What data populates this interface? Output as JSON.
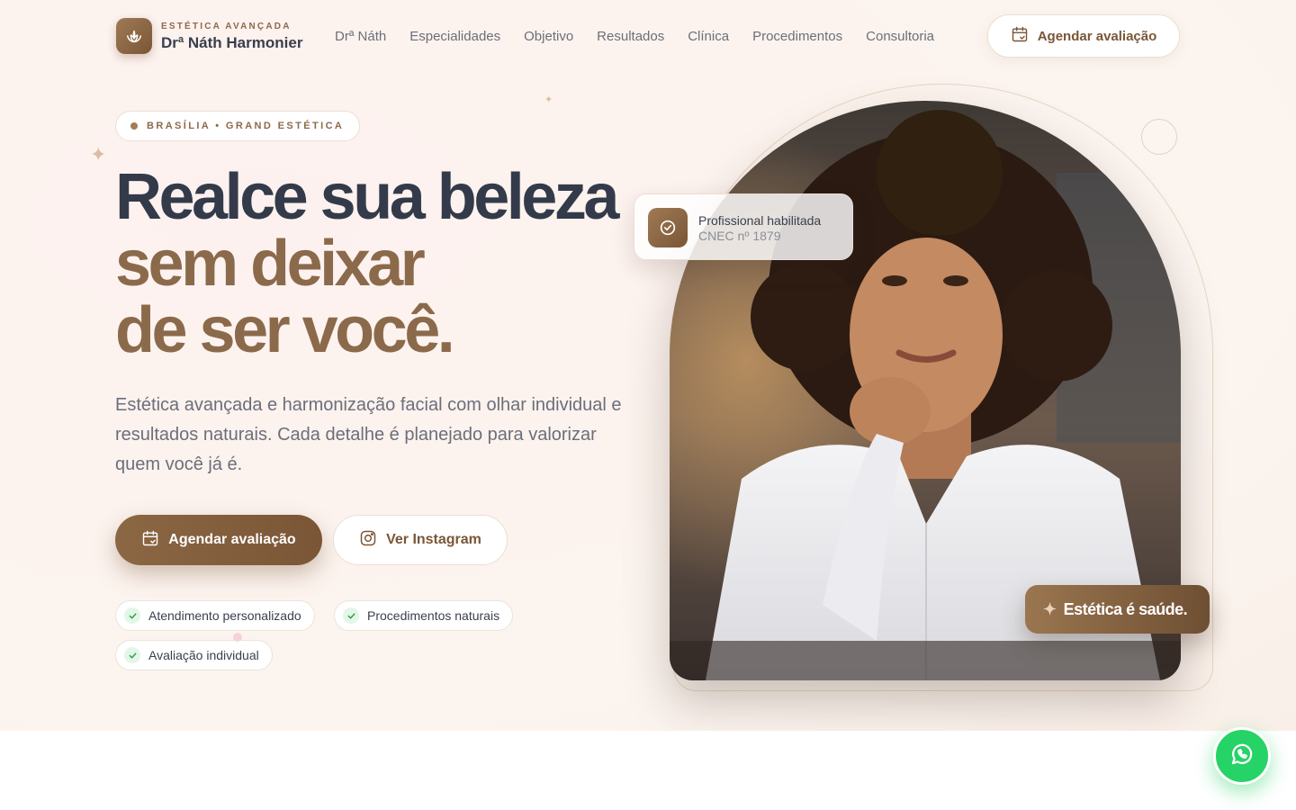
{
  "header": {
    "brand_subtitle": "ESTÉTICA AVANÇADA",
    "brand_name": "Drª Náth Harmonier",
    "nav": [
      {
        "label": "Drª Náth"
      },
      {
        "label": "Especialidades"
      },
      {
        "label": "Objetivo"
      },
      {
        "label": "Resultados"
      },
      {
        "label": "Clínica"
      },
      {
        "label": "Procedimentos"
      },
      {
        "label": "Consultoria"
      }
    ],
    "cta_label": "Agendar avaliação"
  },
  "hero": {
    "location_badge": "BRASÍLIA • GRAND ESTÉTICA",
    "headline_line1": "Realce sua beleza",
    "headline_line2": "sem deixar",
    "headline_line3": "de ser você.",
    "lede": "Estética avançada e harmonização facial com olhar individual e resultados naturais. Cada detalhe é planejado para valorizar quem você já é.",
    "primary_button": "Agendar avaliação",
    "secondary_button": "Ver Instagram",
    "features": [
      "Atendimento personalizado",
      "Procedimentos naturais",
      "Avaliação individual"
    ]
  },
  "credential": {
    "title": "Profissional habilitada",
    "subtitle": "CNEC nº 1879"
  },
  "tagline": "Estética é saúde.",
  "colors": {
    "brand": "#7a5636",
    "brand_light": "#a07a55",
    "heading_dark": "#333b4a",
    "whatsapp": "#25d366"
  },
  "icons": [
    "lotus-icon",
    "calendar-icon",
    "instagram-icon",
    "check-icon",
    "badge-check-icon",
    "sparkle-icon",
    "whatsapp-icon"
  ]
}
